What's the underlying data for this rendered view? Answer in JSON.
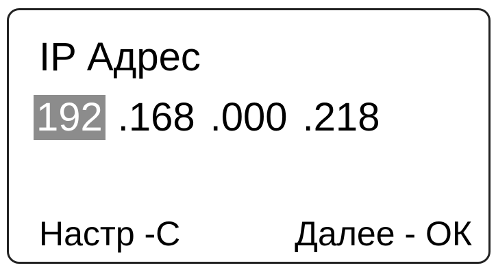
{
  "screen": {
    "title": "IP Адрес",
    "ip": {
      "octets": [
        "192",
        ".168",
        ".000",
        ".218"
      ],
      "selected_index": 0
    },
    "softkeys": {
      "left_label": "Настр -С",
      "right_label": "Далее - ОК"
    }
  },
  "colors": {
    "selection_background": "#8c8c8c",
    "selection_text": "#ffffff",
    "frame_border": "#222222"
  }
}
